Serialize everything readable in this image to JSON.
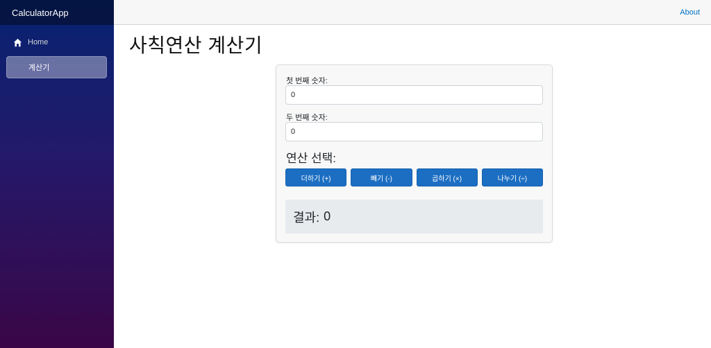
{
  "sidebar": {
    "brand": "CalculatorApp",
    "items": [
      {
        "label": "Home",
        "icon": "home-icon",
        "active": false
      },
      {
        "label": "계산기",
        "icon": "",
        "active": true
      }
    ]
  },
  "topbar": {
    "about_label": "About"
  },
  "page": {
    "title": "사칙연산 계산기"
  },
  "calculator": {
    "first_label": "첫 번째 숫자:",
    "first_value": "0",
    "second_label": "두 번째 숫자:",
    "second_value": "0",
    "operation_title": "연산 선택:",
    "buttons": {
      "add": "더하기 (+)",
      "subtract": "빼기 (-)",
      "multiply": "곱하기 (×)",
      "divide": "나누기 (÷)"
    },
    "result_label": "결과:",
    "result_value": "0"
  },
  "colors": {
    "primary_button": "#1b6ec2",
    "link": "#0071c1",
    "sidebar_top": "#062371",
    "sidebar_bottom": "#3a0647"
  }
}
